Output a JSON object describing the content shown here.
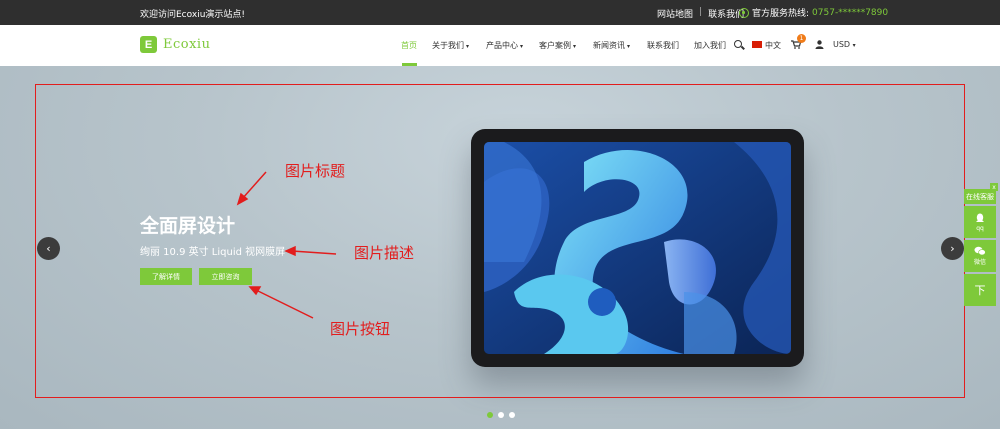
{
  "topbar": {
    "welcome": "欢迎访问Ecoxiu演示站点!",
    "sitemap": "网站地图",
    "separator": "|",
    "contact": "联系我们",
    "hotline_label": "官方服务热线:",
    "hotline_number": "0757-******7890"
  },
  "header": {
    "logo_letter": "E",
    "logo_name": "Ecoxiu",
    "nav": [
      {
        "label": "首页",
        "active": true
      },
      {
        "label": "关于我们"
      },
      {
        "label": "产品中心"
      },
      {
        "label": "客户案例"
      },
      {
        "label": "新闻资讯"
      },
      {
        "label": "联系我们"
      },
      {
        "label": "加入我们"
      }
    ],
    "language": "中文",
    "cart_count": "1",
    "currency": "USD",
    "icons": [
      "search-icon",
      "flag-icon",
      "cart-icon",
      "user-icon",
      "chevron-down-icon"
    ]
  },
  "slide": {
    "title": "全面屏设计",
    "description": "绚丽 10.9 英寸 Liquid 视网膜屏",
    "button_more": "了解详情",
    "button_consult": "立即咨询"
  },
  "annotations": {
    "title_note": "图片标题",
    "desc_note": "图片描述",
    "button_note": "图片按钮"
  },
  "slider_controls": {
    "prev": "‹",
    "next": "›",
    "dots_count": 3,
    "active_dot": 0
  },
  "service": {
    "head": "在线客服",
    "close": "x",
    "qq": "qq",
    "wechat": "微信",
    "down": "下"
  },
  "colors": {
    "accent": "#7ec93a",
    "topbar": "#2f2f2f",
    "annotation": "#e21d1d",
    "badge": "#f07c1a"
  }
}
